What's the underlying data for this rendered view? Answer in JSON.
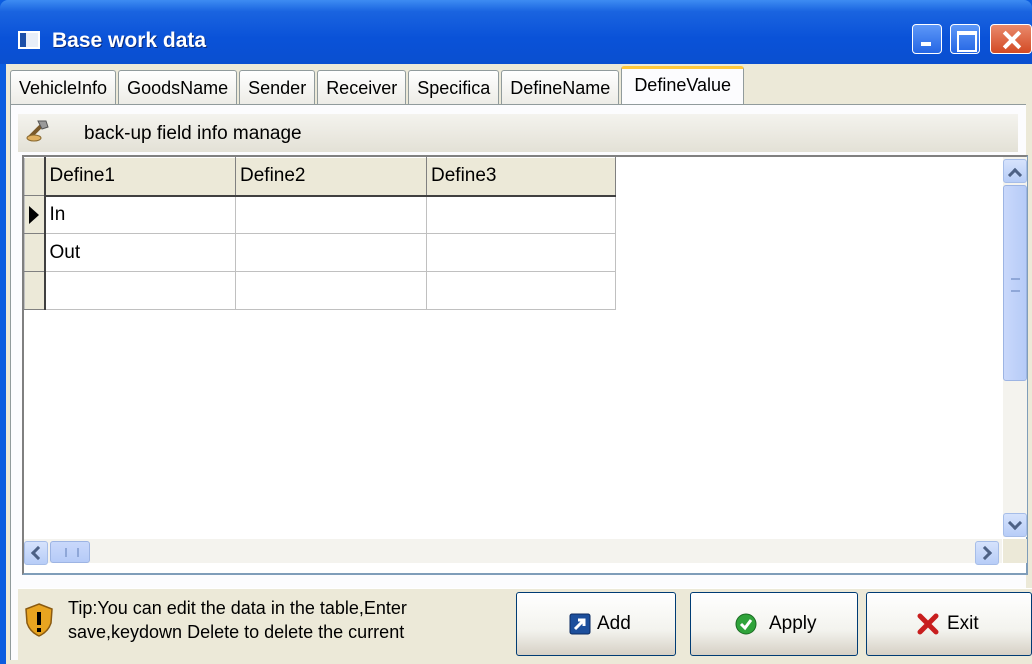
{
  "window": {
    "title": "Base work data"
  },
  "tabs": [
    {
      "label": "VehicleInfo",
      "active": false
    },
    {
      "label": "GoodsName",
      "active": false
    },
    {
      "label": "Sender",
      "active": false
    },
    {
      "label": "Receiver",
      "active": false
    },
    {
      "label": "Specifica",
      "active": false
    },
    {
      "label": "DefineName",
      "active": false
    },
    {
      "label": "DefineValue",
      "active": true
    }
  ],
  "section": {
    "title": "back-up field info manage"
  },
  "grid": {
    "columns": [
      "Define1",
      "Define2",
      "Define3"
    ],
    "rows": [
      [
        "In",
        "",
        ""
      ],
      [
        "Out",
        "",
        ""
      ],
      [
        "",
        "",
        ""
      ]
    ]
  },
  "footer": {
    "tip_line1": "Tip:You can edit the data in the table,Enter",
    "tip_line2": "save,keydown Delete to delete the current",
    "add_label": "Add",
    "apply_label": "Apply",
    "exit_label": "Exit"
  },
  "colors": {
    "titlebar": "#0a52d8",
    "face": "#ece9d8",
    "active_tab_accent": "#ffc83c",
    "apply_icon": "#2fa33a",
    "exit_icon": "#c81e1e"
  }
}
